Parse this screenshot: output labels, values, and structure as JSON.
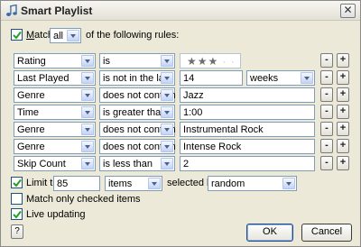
{
  "window": {
    "title": "Smart Playlist",
    "close_glyph": "✕"
  },
  "match": {
    "checked": true,
    "label": "Match",
    "label_accel": "M",
    "quantifier": "all",
    "suffix": "of the following rules:"
  },
  "rules": [
    {
      "field": "Rating",
      "operator": "is",
      "value_type": "stars",
      "stars_filled": 3,
      "stars_total": 5,
      "stars_text": "★★★",
      "stars_off_text": "·  ·"
    },
    {
      "field": "Last Played",
      "operator": "is not in the last",
      "value": "14",
      "unit": "weeks"
    },
    {
      "field": "Genre",
      "operator": "does not contain",
      "value": "Jazz"
    },
    {
      "field": "Time",
      "operator": "is greater than",
      "value": "1:00"
    },
    {
      "field": "Genre",
      "operator": "does not contain",
      "value": "Instrumental Rock"
    },
    {
      "field": "Genre",
      "operator": "does not contain",
      "value": "Intense Rock"
    },
    {
      "field": "Skip Count",
      "operator": "is less than",
      "value": "2"
    }
  ],
  "row_buttons": {
    "remove": "-",
    "add": "+"
  },
  "limit": {
    "checked": true,
    "label": "Limit to",
    "value": "85",
    "unit": "items",
    "selected_by_label": "selected by",
    "selected_by": "random"
  },
  "match_checked_only": {
    "checked": false,
    "label": "Match only checked items"
  },
  "live_updating": {
    "checked": true,
    "label": "Live updating"
  },
  "buttons": {
    "help": "?",
    "ok": "OK",
    "cancel": "Cancel"
  },
  "colors": {
    "check": "#21a121",
    "accent": "#7f9db9"
  }
}
